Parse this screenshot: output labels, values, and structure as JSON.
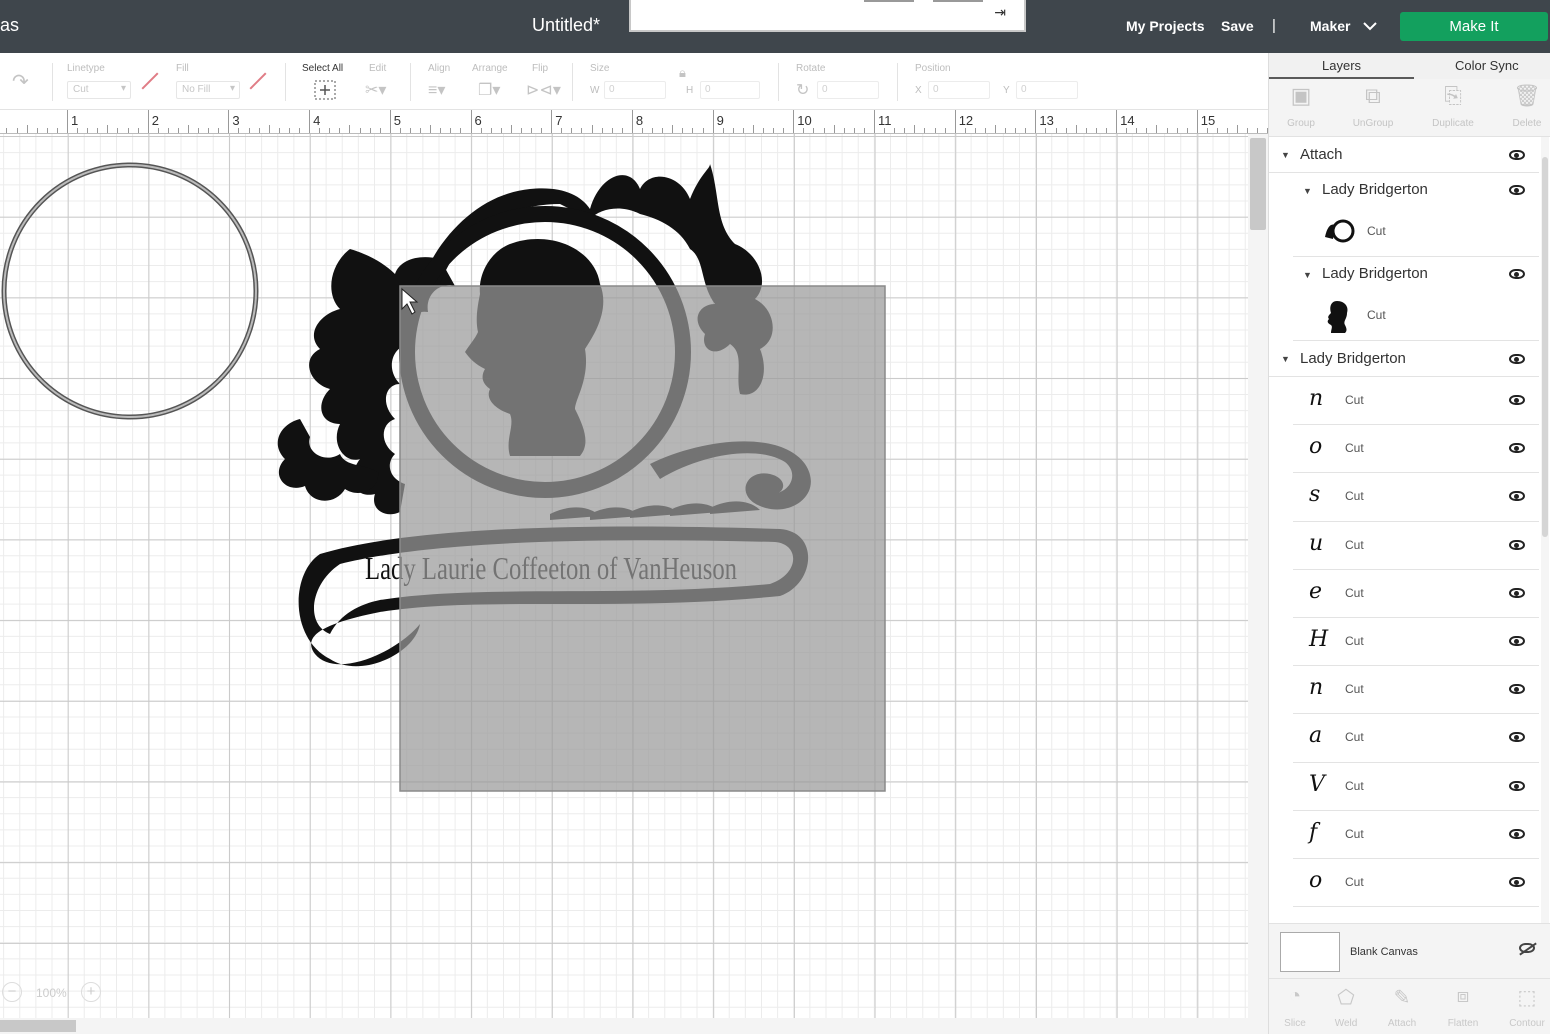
{
  "header": {
    "left_text": "as",
    "title": "Untitled*",
    "my_projects": "My Projects",
    "save": "Save",
    "separator": "|",
    "machine": "Maker",
    "make_it": "Make It"
  },
  "toolbar": {
    "linetype_label": "Linetype",
    "linetype_value": "Cut",
    "fill_label": "Fill",
    "fill_value": "No Fill",
    "select_all_label": "Select All",
    "edit_label": "Edit",
    "align_label": "Align",
    "arrange_label": "Arrange",
    "flip_label": "Flip",
    "size_label": "Size",
    "w_label": "W",
    "h_label": "H",
    "w_value": "0",
    "h_value": "0",
    "rotate_label": "Rotate",
    "rotate_value": "0",
    "position_label": "Position",
    "x_label": "X",
    "y_label": "Y",
    "x_value": "0",
    "y_value": "0"
  },
  "ruler": [
    "1",
    "2",
    "3",
    "4",
    "5",
    "6",
    "7",
    "8",
    "9",
    "10",
    "11",
    "12",
    "13",
    "14",
    "15"
  ],
  "canvas": {
    "text_art": "Lady Laurie Coffeeton of VanHeuson",
    "zoom": "100%"
  },
  "panel": {
    "tab_layers": "Layers",
    "tab_color_sync": "Color Sync",
    "tools": [
      "Group",
      "UnGroup",
      "Duplicate",
      "Delete"
    ],
    "attach_group": "Attach",
    "group_a": "Lady Bridgerton",
    "group_a_cut": "Cut",
    "group_b": "Lady Bridgerton",
    "group_b_cut": "Cut",
    "group_c": "Lady Bridgerton",
    "letters": [
      {
        "glyph": "n",
        "op": "Cut"
      },
      {
        "glyph": "o",
        "op": "Cut"
      },
      {
        "glyph": "s",
        "op": "Cut"
      },
      {
        "glyph": "u",
        "op": "Cut"
      },
      {
        "glyph": "e",
        "op": "Cut"
      },
      {
        "glyph": "H",
        "op": "Cut"
      },
      {
        "glyph": "n",
        "op": "Cut"
      },
      {
        "glyph": "a",
        "op": "Cut"
      },
      {
        "glyph": "V",
        "op": "Cut"
      },
      {
        "glyph": "f",
        "op": "Cut"
      },
      {
        "glyph": "o",
        "op": "Cut"
      }
    ],
    "blank_canvas": "Blank Canvas",
    "bottom_tools": [
      "Slice",
      "Weld",
      "Attach",
      "Flatten",
      "Contour"
    ]
  },
  "colors": {
    "header_bg": "#3f464c",
    "make_it_green": "#13a05e",
    "selection_gray": "#9a9a9a"
  }
}
